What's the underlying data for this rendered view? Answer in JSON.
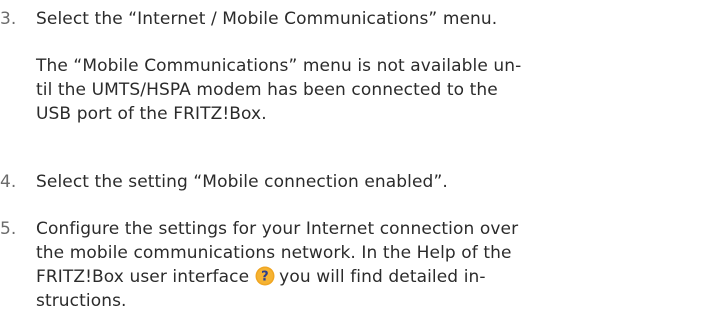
{
  "steps": [
    {
      "number": "3.",
      "lines": [
        "Select the “Internet / Mobile Communications” menu."
      ],
      "note_lines": [
        "The “Mobile Communications” menu is not available un-",
        "til the UMTS/HSPA modem has been connected to the",
        "USB port of the FRITZ!Box."
      ]
    },
    {
      "number": "4.",
      "lines": [
        "Select the setting “Mobile connection enabled”."
      ]
    },
    {
      "number": "5.",
      "lines": [
        "Configure the settings for your Internet connection over",
        "the mobile communications network. In the Help of the",
        "FRITZ!Box user interface",
        "you will find detailed in-",
        "structions."
      ]
    }
  ],
  "help_icon": {
    "name": "help-question-icon",
    "color": "#f0a623",
    "glyph": "?"
  }
}
